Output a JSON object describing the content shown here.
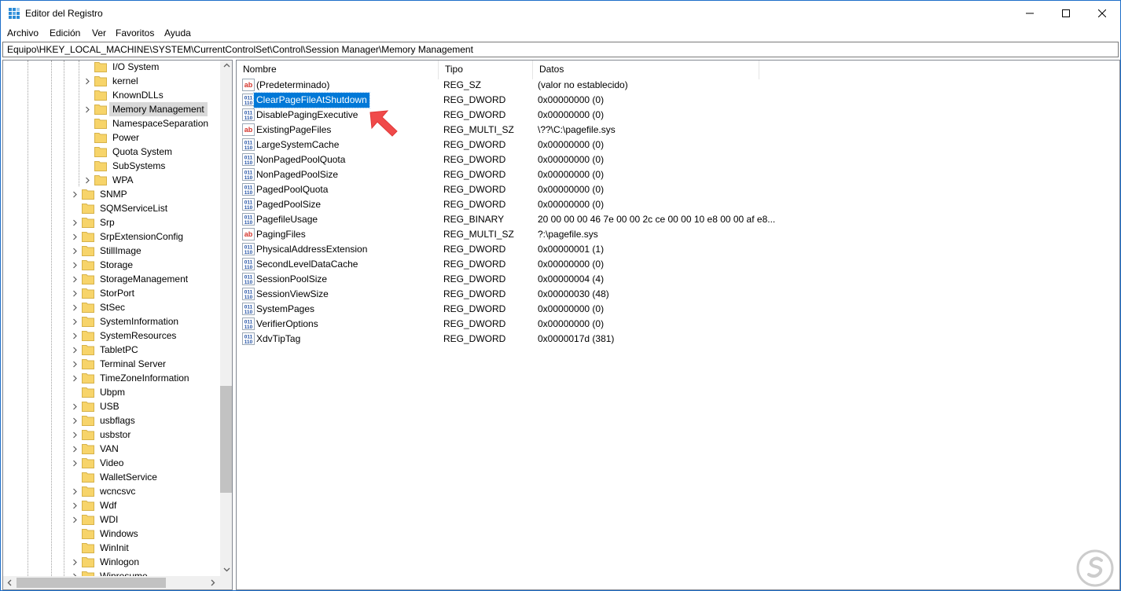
{
  "window": {
    "title": "Editor del Registro",
    "minimize_glyph": "—",
    "maximize_glyph": "☐",
    "close_glyph": "✕"
  },
  "menu": [
    "Archivo",
    "Edición",
    "Ver",
    "Favoritos",
    "Ayuda"
  ],
  "address": "Equipo\\HKEY_LOCAL_MACHINE\\SYSTEM\\CurrentControlSet\\Control\\Session Manager\\Memory Management",
  "tree": {
    "children": [
      {
        "label": "I/O System",
        "expandable": false
      },
      {
        "label": "kernel",
        "expandable": true
      },
      {
        "label": "KnownDLLs",
        "expandable": false
      },
      {
        "label": "Memory Management",
        "expandable": true,
        "selected": true
      },
      {
        "label": "NamespaceSeparation",
        "expandable": false
      },
      {
        "label": "Power",
        "expandable": false
      },
      {
        "label": "Quota System",
        "expandable": false
      },
      {
        "label": "SubSystems",
        "expandable": false
      },
      {
        "label": "WPA",
        "expandable": true
      }
    ],
    "siblings": [
      {
        "label": "SNMP",
        "expandable": true
      },
      {
        "label": "SQMServiceList",
        "expandable": false
      },
      {
        "label": "Srp",
        "expandable": true
      },
      {
        "label": "SrpExtensionConfig",
        "expandable": true
      },
      {
        "label": "StillImage",
        "expandable": true
      },
      {
        "label": "Storage",
        "expandable": true
      },
      {
        "label": "StorageManagement",
        "expandable": true
      },
      {
        "label": "StorPort",
        "expandable": true
      },
      {
        "label": "StSec",
        "expandable": true
      },
      {
        "label": "SystemInformation",
        "expandable": true
      },
      {
        "label": "SystemResources",
        "expandable": true
      },
      {
        "label": "TabletPC",
        "expandable": true
      },
      {
        "label": "Terminal Server",
        "expandable": true
      },
      {
        "label": "TimeZoneInformation",
        "expandable": true
      },
      {
        "label": "Ubpm",
        "expandable": false
      },
      {
        "label": "USB",
        "expandable": true
      },
      {
        "label": "usbflags",
        "expandable": true
      },
      {
        "label": "usbstor",
        "expandable": true
      },
      {
        "label": "VAN",
        "expandable": true
      },
      {
        "label": "Video",
        "expandable": true
      },
      {
        "label": "WalletService",
        "expandable": false
      },
      {
        "label": "wcncsvc",
        "expandable": true
      },
      {
        "label": "Wdf",
        "expandable": true
      },
      {
        "label": "WDI",
        "expandable": true
      },
      {
        "label": "Windows",
        "expandable": false
      },
      {
        "label": "WinInit",
        "expandable": false
      },
      {
        "label": "Winlogon",
        "expandable": true
      },
      {
        "label": "Winresume",
        "expandable": true
      }
    ]
  },
  "columns": {
    "name": "Nombre",
    "type": "Tipo",
    "data": "Datos"
  },
  "values": [
    {
      "name": "(Predeterminado)",
      "type": "REG_SZ",
      "data": "(valor no establecido)",
      "icon": "string-value-icon"
    },
    {
      "name": "ClearPageFileAtShutdown",
      "type": "REG_DWORD",
      "data": "0x00000000 (0)",
      "icon": "binary-value-icon",
      "selected": true
    },
    {
      "name": "DisablePagingExecutive",
      "type": "REG_DWORD",
      "data": "0x00000000 (0)",
      "icon": "binary-value-icon"
    },
    {
      "name": "ExistingPageFiles",
      "type": "REG_MULTI_SZ",
      "data": "\\??\\C:\\pagefile.sys",
      "icon": "string-value-icon"
    },
    {
      "name": "LargeSystemCache",
      "type": "REG_DWORD",
      "data": "0x00000000 (0)",
      "icon": "binary-value-icon"
    },
    {
      "name": "NonPagedPoolQuota",
      "type": "REG_DWORD",
      "data": "0x00000000 (0)",
      "icon": "binary-value-icon"
    },
    {
      "name": "NonPagedPoolSize",
      "type": "REG_DWORD",
      "data": "0x00000000 (0)",
      "icon": "binary-value-icon"
    },
    {
      "name": "PagedPoolQuota",
      "type": "REG_DWORD",
      "data": "0x00000000 (0)",
      "icon": "binary-value-icon"
    },
    {
      "name": "PagedPoolSize",
      "type": "REG_DWORD",
      "data": "0x00000000 (0)",
      "icon": "binary-value-icon"
    },
    {
      "name": "PagefileUsage",
      "type": "REG_BINARY",
      "data": "20 00 00 00 46 7e 00 00 2c ce 00 00 10 e8 00 00 af e8...",
      "icon": "binary-value-icon"
    },
    {
      "name": "PagingFiles",
      "type": "REG_MULTI_SZ",
      "data": "?:\\pagefile.sys",
      "icon": "string-value-icon"
    },
    {
      "name": "PhysicalAddressExtension",
      "type": "REG_DWORD",
      "data": "0x00000001 (1)",
      "icon": "binary-value-icon"
    },
    {
      "name": "SecondLevelDataCache",
      "type": "REG_DWORD",
      "data": "0x00000000 (0)",
      "icon": "binary-value-icon"
    },
    {
      "name": "SessionPoolSize",
      "type": "REG_DWORD",
      "data": "0x00000004 (4)",
      "icon": "binary-value-icon"
    },
    {
      "name": "SessionViewSize",
      "type": "REG_DWORD",
      "data": "0x00000030 (48)",
      "icon": "binary-value-icon"
    },
    {
      "name": "SystemPages",
      "type": "REG_DWORD",
      "data": "0x00000000 (0)",
      "icon": "binary-value-icon"
    },
    {
      "name": "VerifierOptions",
      "type": "REG_DWORD",
      "data": "0x00000000 (0)",
      "icon": "binary-value-icon"
    },
    {
      "name": "XdvTipTag",
      "type": "REG_DWORD",
      "data": "0x0000017d (381)",
      "icon": "binary-value-icon"
    }
  ],
  "colors": {
    "selection": "#0078d7",
    "tree_selection": "#d9d9d9",
    "arrow": "#f04a4a",
    "folder": "#f7d46a"
  }
}
